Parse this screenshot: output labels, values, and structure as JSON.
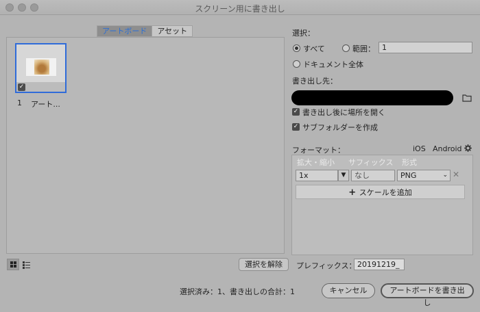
{
  "window": {
    "title": "スクリーン用に書き出し"
  },
  "tabs": [
    {
      "label": "アートボード",
      "active": true
    },
    {
      "label": "アセット",
      "active": false
    }
  ],
  "artboards": [
    {
      "number": "1",
      "label": "アート...",
      "selected": true
    }
  ],
  "select": {
    "title": "選択：",
    "all_label": "すべて",
    "range_label": "範囲：",
    "range_value": "1",
    "document_label": "ドキュメント全体",
    "selected_option": "all"
  },
  "export_to": {
    "title": "書き出し先：",
    "open_after_label": "書き出し後に場所を開く",
    "open_after_checked": true,
    "subfolder_label": "サブフォルダーを作成",
    "subfolder_checked": true
  },
  "formats": {
    "title": "フォーマット：",
    "presets": [
      "iOS",
      "Android"
    ],
    "headers": {
      "scale": "拡大・縮小",
      "suffix": "サフィックス",
      "format": "形式"
    },
    "rows": [
      {
        "scale": "1x",
        "suffix_placeholder": "なし",
        "format": "PNG"
      }
    ],
    "add_scale_label": "スケールを追加"
  },
  "bottom": {
    "deselect_label": "選択を解除",
    "prefix_label": "プレフィックス：",
    "prefix_value": "20191219_",
    "status": "選択済み：1、書き出しの合計：1",
    "cancel_label": "キャンセル",
    "export_label": "アートボードを書き出し"
  },
  "colors": {
    "accent": "#2f6bd9",
    "background": "#b4b4b4"
  }
}
